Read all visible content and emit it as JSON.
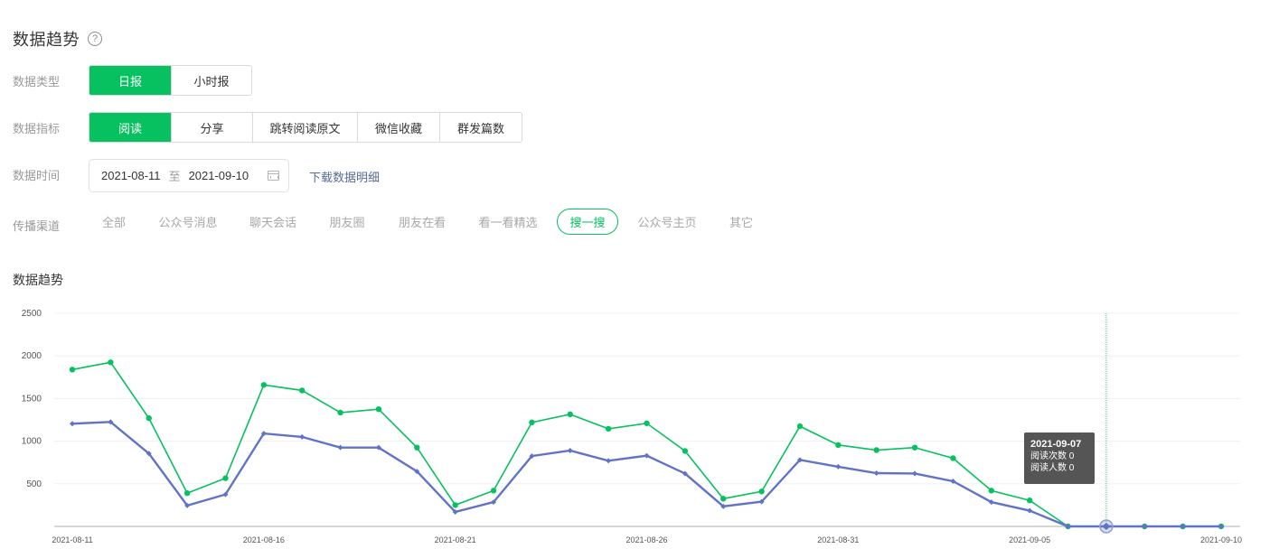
{
  "header": {
    "title": "数据趋势",
    "help_icon": "?"
  },
  "filters": {
    "type": {
      "label": "数据类型",
      "options": [
        "日报",
        "小时报"
      ],
      "selected": "日报"
    },
    "metric": {
      "label": "数据指标",
      "options": [
        "阅读",
        "分享",
        "跳转阅读原文",
        "微信收藏",
        "群发篇数"
      ],
      "selected": "阅读"
    },
    "time": {
      "label": "数据时间",
      "start": "2021-08-11",
      "to": "至",
      "end": "2021-09-10",
      "download": "下载数据明细"
    },
    "channel": {
      "label": "传播渠道",
      "options": [
        "全部",
        "公众号消息",
        "聊天会话",
        "朋友圈",
        "朋友在看",
        "看一看精选",
        "搜一搜",
        "公众号主页",
        "其它"
      ],
      "selected": "搜一搜"
    }
  },
  "chart_title": "数据趋势",
  "colors": {
    "accent": "#07c160",
    "series_reads": "#07c160",
    "series_readers": "#6173c8"
  },
  "tooltip": {
    "date": "2021-09-07",
    "line1": "阅读次数 0",
    "line2": "阅读人数 0"
  },
  "chart_data": {
    "type": "line",
    "x": [
      "2021-08-11",
      "2021-08-12",
      "2021-08-13",
      "2021-08-14",
      "2021-08-15",
      "2021-08-16",
      "2021-08-17",
      "2021-08-18",
      "2021-08-19",
      "2021-08-20",
      "2021-08-21",
      "2021-08-22",
      "2021-08-23",
      "2021-08-24",
      "2021-08-25",
      "2021-08-26",
      "2021-08-27",
      "2021-08-28",
      "2021-08-29",
      "2021-08-30",
      "2021-08-31",
      "2021-09-01",
      "2021-09-02",
      "2021-09-03",
      "2021-09-04",
      "2021-09-05",
      "2021-09-06",
      "2021-09-07",
      "2021-09-08",
      "2021-09-09",
      "2021-09-10"
    ],
    "x_tick_labels": [
      "2021-08-11",
      "2021-08-16",
      "2021-08-21",
      "2021-08-26",
      "2021-08-31",
      "2021-09-05",
      "2021-09-10"
    ],
    "y_ticks": [
      500,
      1000,
      1500,
      2000,
      2500
    ],
    "ylim": [
      0,
      2500
    ],
    "series": [
      {
        "name": "阅读次数",
        "marker": "circle",
        "values": [
          1840,
          1925,
          1270,
          390,
          565,
          1660,
          1595,
          1335,
          1375,
          925,
          250,
          420,
          1220,
          1315,
          1145,
          1210,
          885,
          325,
          410,
          1175,
          955,
          895,
          925,
          800,
          420,
          305,
          0,
          0,
          0,
          0,
          0
        ]
      },
      {
        "name": "阅读人数",
        "marker": "diamond",
        "values": [
          1205,
          1225,
          855,
          245,
          375,
          1090,
          1050,
          925,
          925,
          645,
          170,
          285,
          825,
          890,
          770,
          830,
          620,
          235,
          290,
          780,
          700,
          625,
          620,
          530,
          285,
          185,
          0,
          0,
          0,
          0,
          0
        ]
      }
    ],
    "highlight_index": 27,
    "grid": true
  }
}
